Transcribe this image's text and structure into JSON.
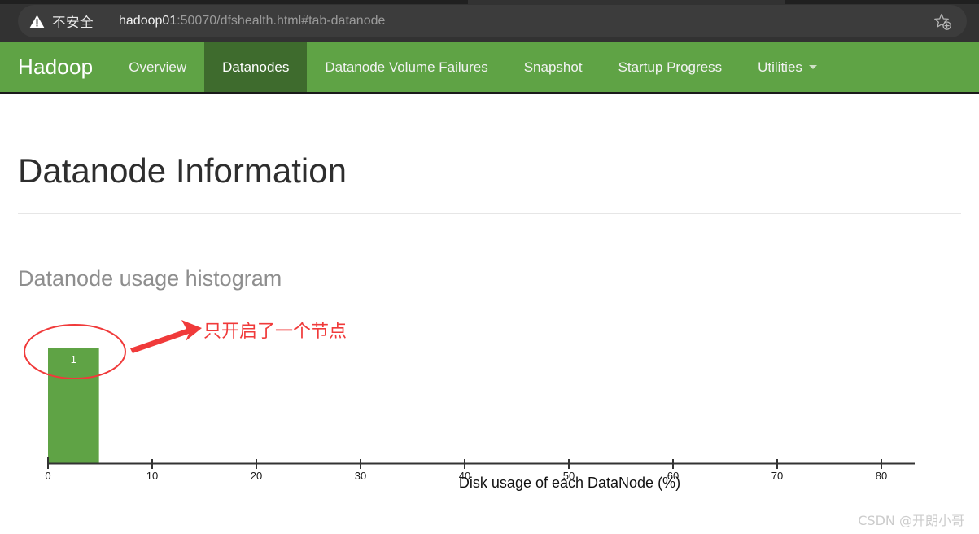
{
  "browser": {
    "security_label": "不安全",
    "security_icon": "warning-triangle-icon",
    "url_host": "hadoop01",
    "url_rest": ":50070/dfshealth.html#tab-datanode",
    "bookmark_icon": "star-plus-icon"
  },
  "nav": {
    "brand": "Hadoop",
    "items": [
      {
        "label": "Overview",
        "active": false,
        "caret": false
      },
      {
        "label": "Datanodes",
        "active": true,
        "caret": false
      },
      {
        "label": "Datanode Volume Failures",
        "active": false,
        "caret": false
      },
      {
        "label": "Snapshot",
        "active": false,
        "caret": false
      },
      {
        "label": "Startup Progress",
        "active": false,
        "caret": false
      },
      {
        "label": "Utilities",
        "active": false,
        "caret": true
      }
    ],
    "accent_color": "#5fa345",
    "active_color": "#3e6b2d"
  },
  "main": {
    "page_title": "Datanode Information",
    "section_heading": "Datanode usage histogram"
  },
  "annotation": {
    "text": "只开启了一个节点",
    "color": "#f03a3a",
    "ellipse_name": "red-ellipse-highlight",
    "arrow_name": "red-arrow"
  },
  "watermark": "CSDN @开朗小哥",
  "chart_data": {
    "type": "bar",
    "title": "Datanode usage histogram",
    "xlabel": "Disk usage of each DataNode (%)",
    "ylabel": "",
    "categories": [
      "0-5"
    ],
    "values": [
      1
    ],
    "data_labels": [
      "1"
    ],
    "bar_color": "#5fa345",
    "bar_label_color": "#ffffff",
    "xlim": [
      0,
      85
    ],
    "xticks": [
      0,
      10,
      20,
      30,
      40,
      50,
      60,
      70,
      80
    ],
    "xticklabels": [
      "0",
      "10",
      "20",
      "30",
      "40",
      "50",
      "60",
      "70",
      "80"
    ],
    "ylim": [
      0,
      1
    ],
    "grid": false,
    "legend": false
  }
}
